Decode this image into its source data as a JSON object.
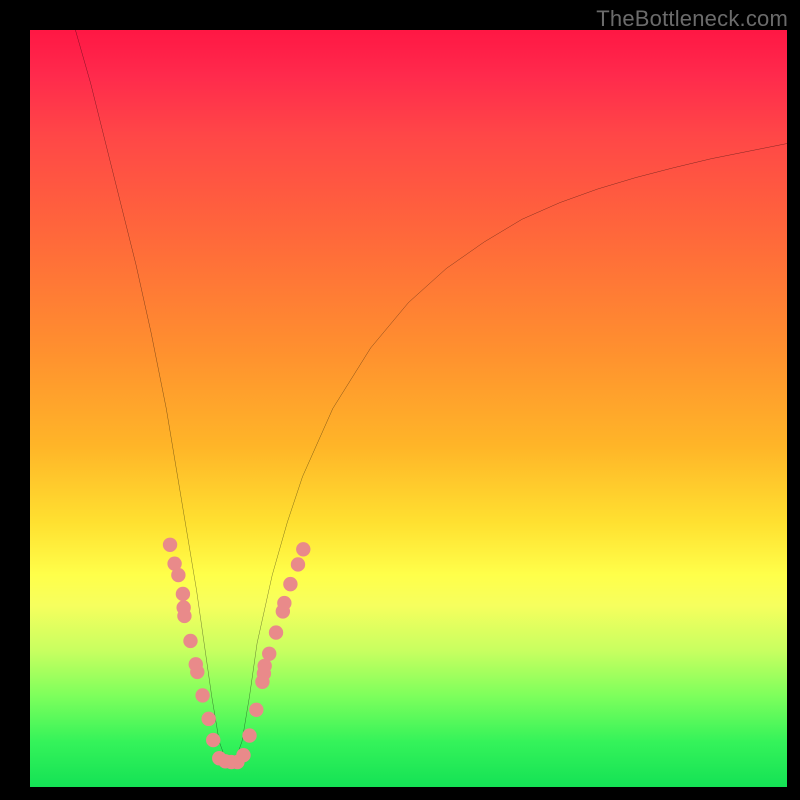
{
  "watermark": "TheBottleneck.com",
  "colors": {
    "curve_stroke": "#000000",
    "dot_fill": "#e98a8a",
    "background_black": "#000000"
  },
  "chart_data": {
    "type": "line",
    "title": "",
    "xlabel": "",
    "ylabel": "",
    "xlim": [
      0,
      100
    ],
    "ylim": [
      0,
      100
    ],
    "series": [
      {
        "name": "bottleneck-curve",
        "x": [
          6,
          8,
          10,
          12,
          14,
          16,
          18,
          20,
          21,
          22,
          23,
          24,
          25,
          26,
          27,
          28,
          29,
          30,
          32,
          34,
          36,
          40,
          45,
          50,
          55,
          60,
          65,
          70,
          75,
          80,
          85,
          90,
          95,
          100
        ],
        "y": [
          100,
          93,
          85,
          77,
          69,
          60,
          50,
          38,
          32,
          26,
          19,
          12,
          6,
          3.2,
          3.2,
          6,
          12,
          19,
          28,
          35,
          41,
          50,
          58,
          64,
          68.5,
          72,
          75,
          77.2,
          79,
          80.5,
          81.8,
          83,
          84,
          85
        ]
      }
    ],
    "dots": {
      "name": "highlight-dots",
      "points": [
        {
          "x": 18.5,
          "y": 32
        },
        {
          "x": 19.1,
          "y": 29.5
        },
        {
          "x": 19.6,
          "y": 28
        },
        {
          "x": 20.2,
          "y": 25.5
        },
        {
          "x": 20.3,
          "y": 23.7
        },
        {
          "x": 20.4,
          "y": 22.6
        },
        {
          "x": 21.2,
          "y": 19.3
        },
        {
          "x": 21.9,
          "y": 16.2
        },
        {
          "x": 22.1,
          "y": 15.2
        },
        {
          "x": 22.8,
          "y": 12.1
        },
        {
          "x": 23.6,
          "y": 9.0
        },
        {
          "x": 24.2,
          "y": 6.2
        },
        {
          "x": 25.0,
          "y": 3.8
        },
        {
          "x": 25.8,
          "y": 3.4
        },
        {
          "x": 26.6,
          "y": 3.3
        },
        {
          "x": 27.4,
          "y": 3.3
        },
        {
          "x": 28.2,
          "y": 4.2
        },
        {
          "x": 29.0,
          "y": 6.8
        },
        {
          "x": 29.9,
          "y": 10.2
        },
        {
          "x": 30.7,
          "y": 13.9
        },
        {
          "x": 30.9,
          "y": 15.0
        },
        {
          "x": 31.0,
          "y": 16.0
        },
        {
          "x": 31.6,
          "y": 17.6
        },
        {
          "x": 32.5,
          "y": 20.4
        },
        {
          "x": 33.4,
          "y": 23.2
        },
        {
          "x": 33.6,
          "y": 24.3
        },
        {
          "x": 34.4,
          "y": 26.8
        },
        {
          "x": 35.4,
          "y": 29.4
        },
        {
          "x": 36.1,
          "y": 31.4
        }
      ]
    }
  }
}
